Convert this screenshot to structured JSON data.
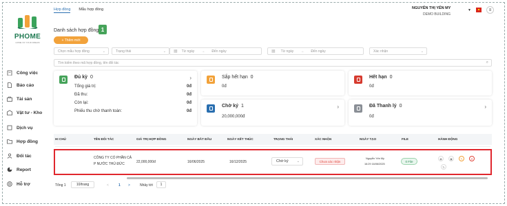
{
  "header": {
    "tabs": [
      "Hợp đồng",
      "Mẫu hợp đồng"
    ],
    "user_name": "NGUYỄN THỊ YẾN MY",
    "user_org": "DEMO BUILDING",
    "menu_glyph": "≡"
  },
  "sidebar": {
    "brand": "PHOME",
    "tagline": "HOME OF YOUR DREAM",
    "items": [
      {
        "label": "Công việc",
        "icon": "clipboard-icon"
      },
      {
        "label": "Báo cáo",
        "icon": "document-icon"
      },
      {
        "label": "Tài sản",
        "icon": "briefcase-icon"
      },
      {
        "label": "Vật tư - Kho",
        "icon": "warehouse-icon"
      },
      {
        "label": "Dịch vụ",
        "icon": "service-icon"
      },
      {
        "label": "Hợp đồng",
        "icon": "folder-icon"
      },
      {
        "label": "Đối tác",
        "icon": "user-icon"
      },
      {
        "label": "Report",
        "icon": "chart-icon"
      },
      {
        "label": "Hỗ trợ",
        "icon": "help-icon"
      }
    ]
  },
  "main": {
    "title": "Danh sách hợp đồng",
    "count": "1",
    "add_label": "+ Thêm mới",
    "filters": {
      "contract_type": "Chọn mẫu hợp đồng",
      "status": "Trạng thái",
      "from_date": "Từ ngày",
      "to_date": "Đến ngày",
      "from_date2": "Từ ngày",
      "to_date2": "Đến ngày",
      "confirm": "Xác nhận",
      "arrow1": "→",
      "arrow2": "→"
    },
    "search_placeholder": "Tìm kiếm theo mã hợp đồng, tên đối tác"
  },
  "cards": {
    "valid": {
      "title": "Đủ kỳ",
      "count": "0",
      "lines": [
        {
          "label": "Tổng giá trị:",
          "value": "0đ"
        },
        {
          "label": "Đã thu:",
          "value": "0đ"
        },
        {
          "label": "Còn lại:",
          "value": "0đ"
        },
        {
          "label": "Phiếu thu chờ thanh toán:",
          "value": "0đ"
        }
      ],
      "color": "#46a35a"
    },
    "expiring": {
      "title": "Sắp hết hạn",
      "count": "0",
      "value": "0đ",
      "color": "#f2a23a"
    },
    "expired": {
      "title": "Hết hạn",
      "count": "0",
      "value": "0đ",
      "color": "#d63b2f"
    },
    "pending": {
      "title": "Chờ ký",
      "count": "1",
      "value": "20,000,000đ",
      "color": "#2a6fb0"
    },
    "liquidated": {
      "title": "Đã Thanh lý",
      "count": "0",
      "value": "0đ",
      "color": "#8a8f96"
    }
  },
  "table": {
    "headers": [
      "HI CHÚ",
      "TÊN ĐỐI TÁC",
      "GIÁ TRỊ HỢP ĐỒNG",
      "NGÀY BẮT ĐẦU",
      "NGÀY KẾT THÚC",
      "TRẠNG THÁI",
      "XÁC NHẬN",
      "NGÀY TẠO",
      "FILE",
      "HÀNH ĐỘNG"
    ],
    "row": {
      "partner_line1": "CÔNG TY CỔ PHẦN CẢ",
      "partner_line2": "P NƯỚC THỦ ĐỨC",
      "value": "22,000,000đ",
      "start": "16/06/2025",
      "end": "16/12/2025",
      "status": "Chờ ký",
      "confirm": "Chưa xác nhận",
      "creator": "Nguyễn Yến My",
      "created_at": "16:29 16/06/2025",
      "file": "0 File"
    }
  },
  "pagination": {
    "total": "Tổng 1",
    "page_size": "10/trang",
    "page": "1",
    "goto_label": "Nhảy tới",
    "goto_value": "1",
    "prev": "<",
    "next": ">"
  }
}
